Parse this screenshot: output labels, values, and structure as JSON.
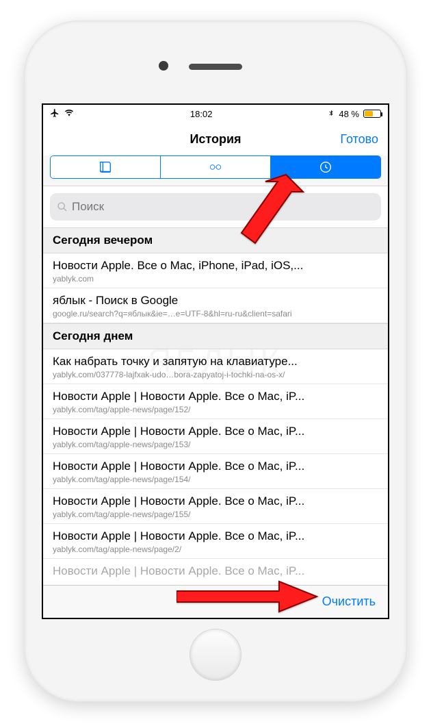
{
  "statusbar": {
    "time": "18:02",
    "battery_text": "48 %"
  },
  "header": {
    "title": "История",
    "done": "Готово"
  },
  "search": {
    "placeholder": "Поиск"
  },
  "sections": [
    {
      "header": "Сегодня вечером",
      "rows": [
        {
          "title": "Новости Apple. Все о Mac, iPhone, iPad, iOS,...",
          "url": "yablyk.com"
        },
        {
          "title": "яблык - Поиск в Google",
          "url": "google.ru/search?q=яблык&ie=…e=UTF-8&hl=ru-ru&client=safari"
        }
      ]
    },
    {
      "header": "Сегодня днем",
      "rows": [
        {
          "title": "Как набрать точку и запятую на клавиатуре...",
          "url": "yablyk.com/037778-lajfxak-udo…bora-zapyatoj-i-tochki-na-os-x/"
        },
        {
          "title": "Новости Apple | Новости Apple. Все о Mac, iP...",
          "url": "yablyk.com/tag/apple-news/page/152/"
        },
        {
          "title": "Новости Apple | Новости Apple. Все о Mac, iP...",
          "url": "yablyk.com/tag/apple-news/page/153/"
        },
        {
          "title": "Новости Apple | Новости Apple. Все о Mac, iP...",
          "url": "yablyk.com/tag/apple-news/page/154/"
        },
        {
          "title": "Новости Apple | Новости Apple. Все о Mac, iP...",
          "url": "yablyk.com/tag/apple-news/page/155/"
        },
        {
          "title": "Новости Apple | Новости Apple. Все о Mac, iP...",
          "url": "yablyk.com/tag/apple-news/page/2/"
        },
        {
          "title": "Новости Apple | Новости Apple. Все о Mac, iP...",
          "url": ""
        }
      ]
    }
  ],
  "toolbar": {
    "clear": "Очистить"
  },
  "watermark": "ЯБЛЫК"
}
